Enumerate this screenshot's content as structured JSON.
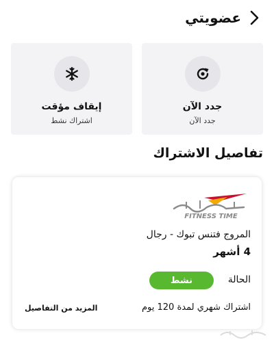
{
  "header": {
    "title": "عضويتي"
  },
  "actions": [
    {
      "title": "جدد الآن",
      "subtitle": "جدد الآن",
      "icon": "renew-icon"
    },
    {
      "title": "إيقاف مؤقت",
      "subtitle": "اشتراك نشط",
      "icon": "snowflake-icon"
    }
  ],
  "section": {
    "title": "تفاصيل الاشتراك"
  },
  "subscription": {
    "logo_text": "FITNESS TIME",
    "gym_name": "المروج فتنس تبوك - رجال",
    "duration": "4 أشهر",
    "status_label": "الحالة",
    "status_value": "نشط",
    "plan_description": "اشتراك شهري لمدة 120 يوم",
    "more_details": "المزيد من التفاصيل"
  },
  "colors": {
    "status_active": "#58b82f",
    "card_bg": "#f3f3f5",
    "logo_red": "#c8102e",
    "logo_yellow": "#f2a900",
    "logo_gray": "#8a8a8a"
  }
}
